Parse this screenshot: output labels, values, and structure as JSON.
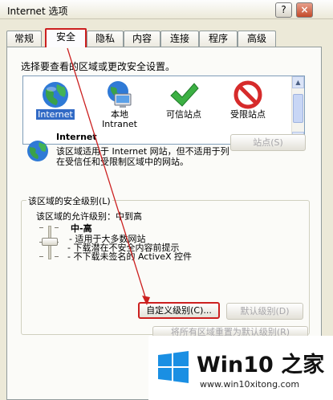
{
  "window": {
    "title": "Internet 选项",
    "help_label": "?",
    "close_label": "×"
  },
  "tabs": [
    {
      "label": "常规"
    },
    {
      "label": "安全"
    },
    {
      "label": "隐私"
    },
    {
      "label": "内容"
    },
    {
      "label": "连接"
    },
    {
      "label": "程序"
    },
    {
      "label": "高级"
    }
  ],
  "active_tab": "安全",
  "security": {
    "prompt": "选择要查看的区域或更改安全设置。",
    "zones": [
      {
        "label": "Internet",
        "icon": "globe-icon",
        "selected": true
      },
      {
        "label": "本地\nIntranet",
        "icon": "intranet-computer-icon"
      },
      {
        "label": "可信站点",
        "icon": "checkmark-icon"
      },
      {
        "label": "受限站点",
        "icon": "no-entry-icon"
      }
    ],
    "zone_name": "Internet",
    "zone_desc": "该区域适用于 Internet 网站，但不适用于列在受信任和受限制区域中的网站。",
    "sites_button": "站点(S)",
    "level_group_title": "该区域的安全级别(L)",
    "allowed_levels": "该区域的允许级别：中到高",
    "level_name": "中-高",
    "level_items": [
      "- 适用于大多数网站",
      "- 下载潜在不安全内容前提示",
      "- 不下载未签名的 ActiveX 控件"
    ],
    "custom_level_button": "自定义级别(C)...",
    "default_level_button": "默认级别(D)",
    "reset_all_button": "将所有区域重置为默认级别(R)"
  },
  "watermark": {
    "brand": "Win10 之家",
    "url": "www.win10xitong.com"
  },
  "colors": {
    "annotation_red": "#cc2020",
    "dialog_bg": "#ece9d8",
    "selection_blue": "#316ac5"
  }
}
